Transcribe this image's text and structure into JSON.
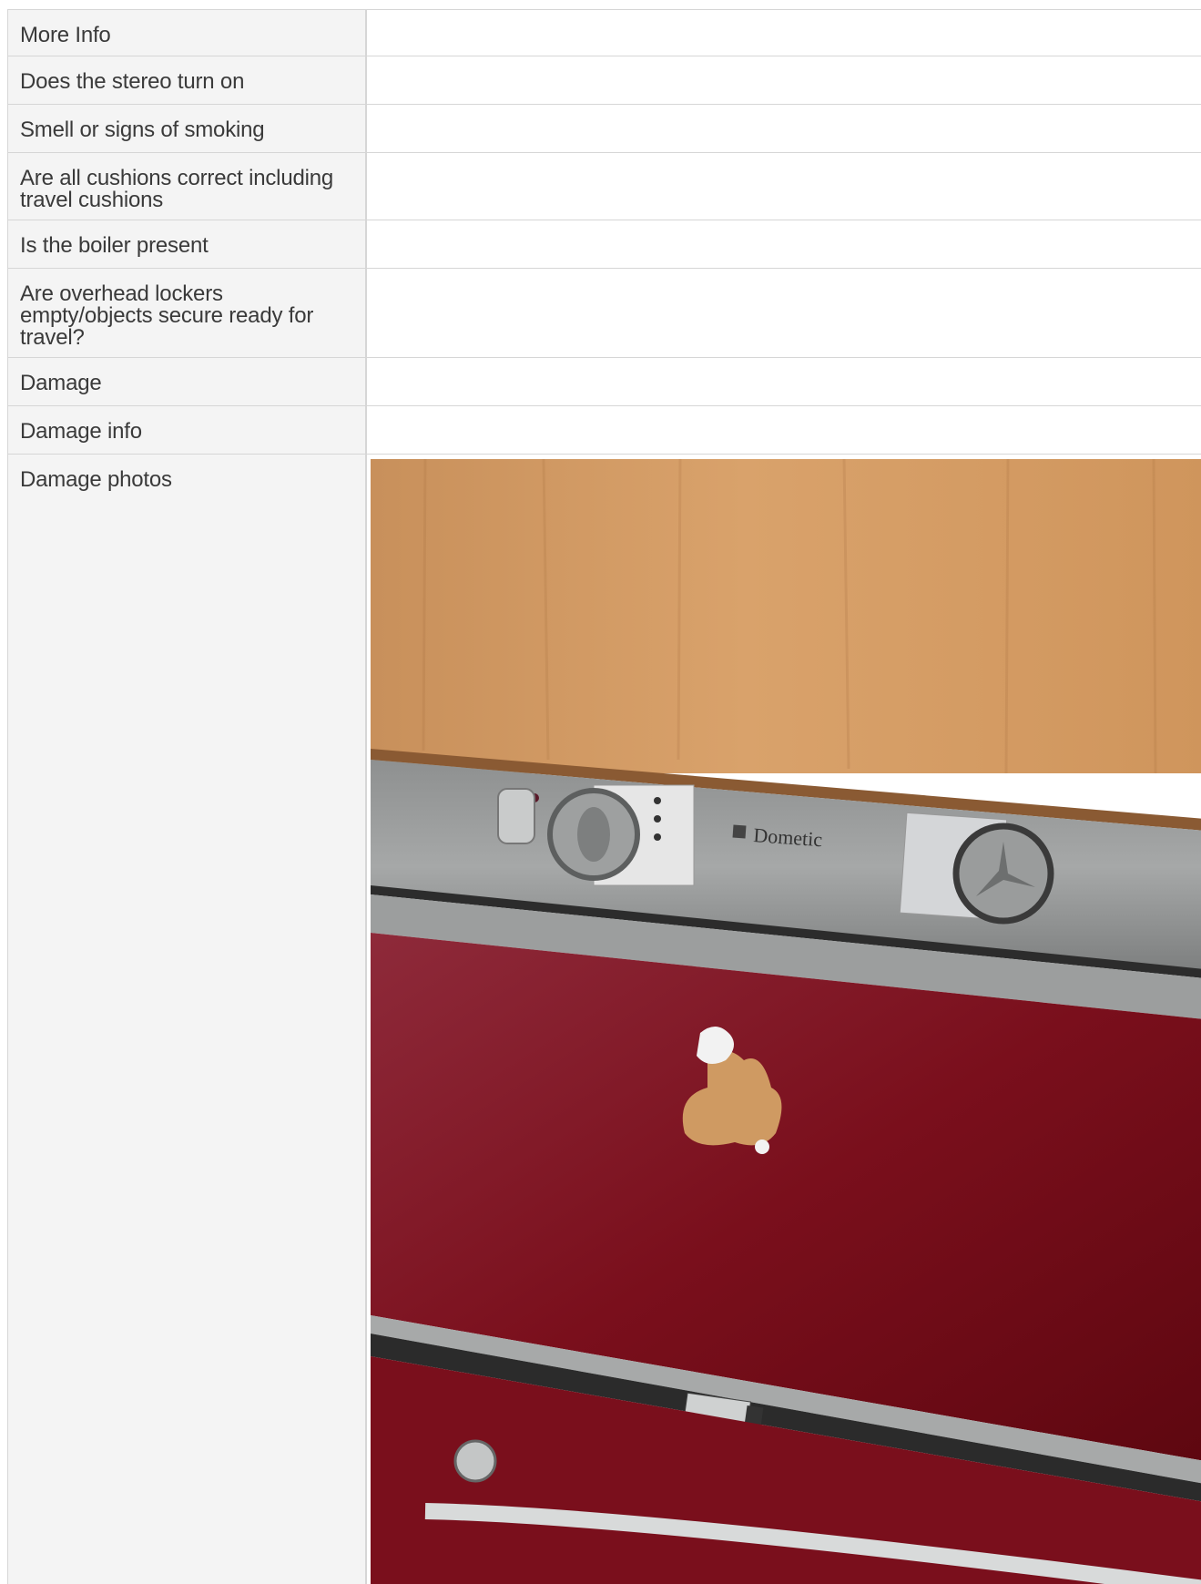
{
  "rows": [
    {
      "label": "More Info",
      "value": ""
    },
    {
      "label": "Does the stereo turn on",
      "value": ""
    },
    {
      "label": "Smell or signs of smoking",
      "value": ""
    },
    {
      "label": "Are all cushions correct including travel cushions",
      "value": ""
    },
    {
      "label": "Is the boiler present",
      "value": ""
    },
    {
      "label": "Are overhead lockers empty/objects secure ready for travel?",
      "value": ""
    },
    {
      "label": "Damage",
      "value": ""
    },
    {
      "label": "Damage info",
      "value": ""
    },
    {
      "label": "Damage photos",
      "value": ""
    }
  ],
  "photo": {
    "brand_text": "Dometic"
  }
}
